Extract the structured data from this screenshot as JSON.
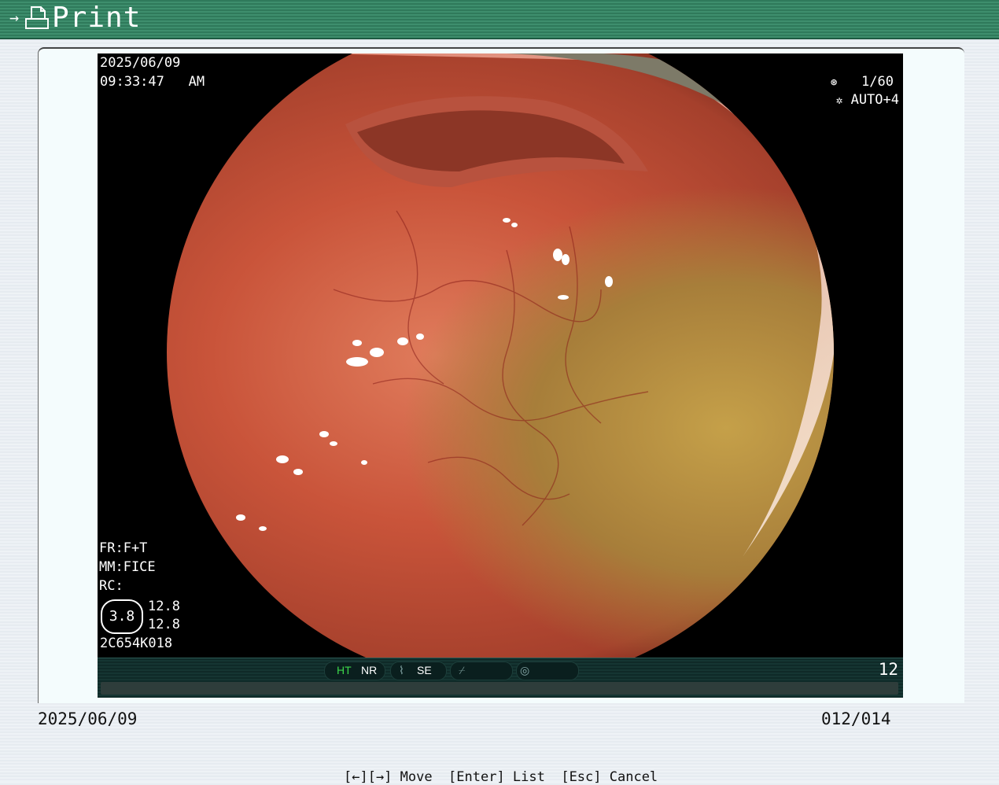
{
  "header": {
    "title": "Print",
    "icon": "printer-icon"
  },
  "image": {
    "date": "2025/06/09",
    "time": "09:33:47",
    "ampm": "AM",
    "shutter": "1/60",
    "exposure": "AUTO+4",
    "fr": "FR:F+T",
    "mm": "MM:FICE",
    "rc": "RC:",
    "zoom": "3.8",
    "value1": "12.8",
    "value2": "12.8",
    "serial": "2C654K018"
  },
  "statusbar": {
    "ht": "HT",
    "nr": "NR",
    "se": "SE",
    "counter": "12",
    "ht_color": "#3cd64a"
  },
  "footer": {
    "date": "2025/06/09",
    "index": "012/014"
  },
  "help": {
    "text": "[←][→] Move  [Enter] List  [Esc] Cancel"
  }
}
